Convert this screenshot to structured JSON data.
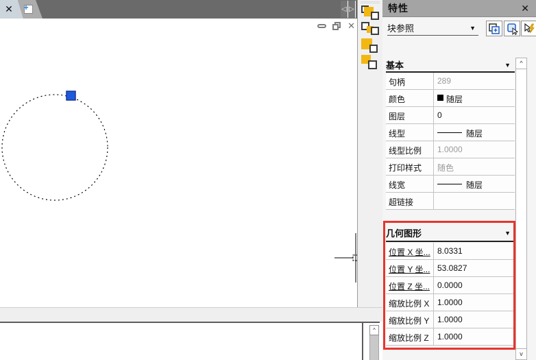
{
  "colors": {
    "highlight_red": "#e8352c",
    "grip_blue": "#1e5ae0",
    "icon_yellow": "#f2b711"
  },
  "tabbar": {
    "close_tab_icon": "✕",
    "new_tab_plus_icon": "+",
    "scroll_left_icon": "◁",
    "scroll_right_icon": "▷"
  },
  "canvas_window": {
    "close_icon": "✕"
  },
  "bottom_pane": {
    "scroll_up_icon": "^"
  },
  "properties_panel": {
    "title": "特性",
    "close_icon": "✕",
    "object_type": {
      "value": "块参照",
      "dropdown_icon": "▼"
    },
    "toolbar": {
      "pickadd_icon": "toggle-pickadd",
      "select_objects_icon": "select-objects",
      "quick_select_icon": "quick-select"
    },
    "scrollbar": {
      "up_icon": "^",
      "down_icon": "v"
    },
    "sections": [
      {
        "title": "基本",
        "collapse_icon": "▼",
        "rows": [
          {
            "label": "句柄",
            "value": "289"
          },
          {
            "label": "颜色",
            "value": "随层"
          },
          {
            "label": "图层",
            "value": "0"
          },
          {
            "label": "线型",
            "value": "随层"
          },
          {
            "label": "线型比例",
            "value": "1.0000"
          },
          {
            "label": "打印样式",
            "value": "随色"
          },
          {
            "label": "线宽",
            "value": "随层"
          },
          {
            "label": "超链接",
            "value": ""
          }
        ]
      },
      {
        "title": "几何图形",
        "collapse_icon": "▼",
        "rows": [
          {
            "label": "位置 X 坐...",
            "value": "8.0331"
          },
          {
            "label": "位置 Y 坐...",
            "value": "53.0827"
          },
          {
            "label": "位置 Z 坐...",
            "value": "0.0000"
          },
          {
            "label": "缩放比例 X",
            "value": "1.0000"
          },
          {
            "label": "缩放比例 Y",
            "value": "1.0000"
          },
          {
            "label": "缩放比例 Z",
            "value": "1.0000"
          }
        ]
      }
    ]
  }
}
